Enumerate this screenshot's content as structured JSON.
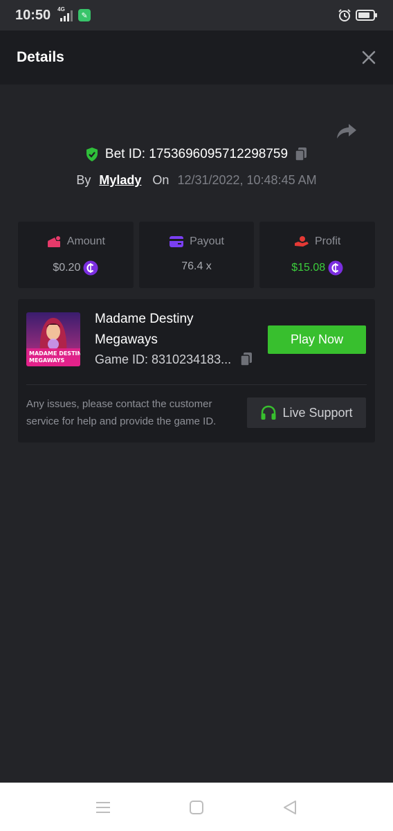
{
  "status_bar": {
    "time": "10:50",
    "network": "4G",
    "icons": [
      "signal-icon",
      "app-notification-icon",
      "alarm-icon",
      "battery-icon"
    ]
  },
  "header": {
    "title": "Details",
    "close_icon": "close-icon"
  },
  "bet": {
    "bet_id_label": "Bet ID: 1753696095712298759",
    "by_label": "By",
    "user": "Mylady",
    "on_label": "On",
    "datetime": "12/31/2022, 10:48:45 AM"
  },
  "stats": [
    {
      "label": "Amount",
      "value": "$0.20",
      "icon": "amount-icon",
      "has_coin": true,
      "color": "#a9abb1"
    },
    {
      "label": "Payout",
      "value": "76.4 x",
      "icon": "payout-card-icon",
      "has_coin": false,
      "color": "#a9abb1"
    },
    {
      "label": "Profit",
      "value": "$15.08",
      "icon": "profit-hand-icon",
      "has_coin": true,
      "color": "#3ccd3c"
    }
  ],
  "game": {
    "name": "Madame Destiny Megaways",
    "game_id_label": "Game ID: 8310234183...",
    "thumb_title": "MADAME DESTINY",
    "thumb_subtitle": "MEGAWAYS",
    "play_label": "Play Now"
  },
  "support": {
    "help_text": "Any issues, please contact the customer service for help and provide the game ID.",
    "button_label": "Live Support"
  },
  "colors": {
    "background": "#232428",
    "card": "#1b1c20",
    "accent_green": "#38bf2e",
    "profit_green": "#3ccd3c",
    "coin_purple": "#7b2ee0",
    "shield_green": "#2fbf3a"
  },
  "nav": {
    "icons": [
      "menu-icon",
      "home-icon",
      "back-icon"
    ]
  }
}
